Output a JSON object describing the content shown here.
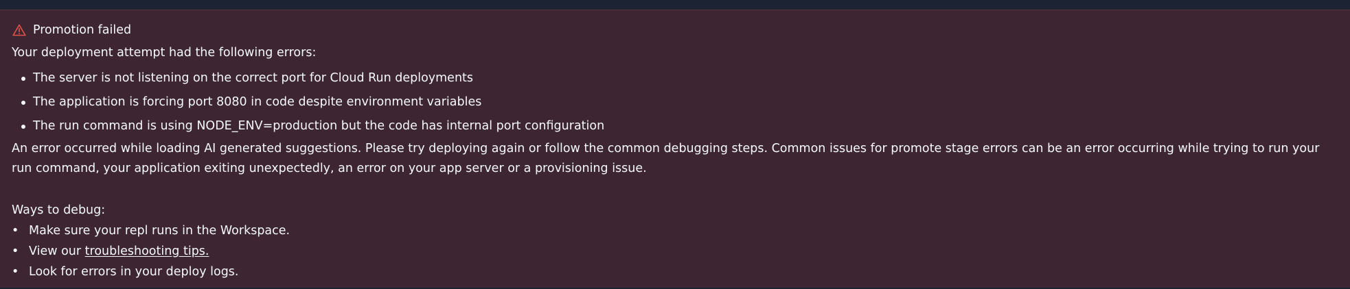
{
  "alert": {
    "title": "Promotion failed",
    "icon": "warning-triangle-icon",
    "icon_color": "#e5534b",
    "background": "#3d2532"
  },
  "intro": "Your deployment attempt had the following errors:",
  "errors": [
    "The server is not listening on the correct port for Cloud Run deployments",
    "The application is forcing port 8080 in code despite environment variables",
    "The run command is using NODE_ENV=production but the code has internal port configuration"
  ],
  "ai_message": "An error occurred while loading AI generated suggestions. Please try deploying again or follow the common debugging steps. Common issues for promote stage errors can be an error occurring while trying to run your run command, your application exiting unexpectedly, an error on your app server or a provisioning issue.",
  "debug": {
    "title": "Ways to debug:",
    "bullet": "•",
    "items": [
      {
        "text": "Make sure your repl runs in the Workspace."
      },
      {
        "prefix": "View our ",
        "link": "troubleshooting tips."
      },
      {
        "text": "Look for errors in your deploy logs."
      }
    ]
  }
}
